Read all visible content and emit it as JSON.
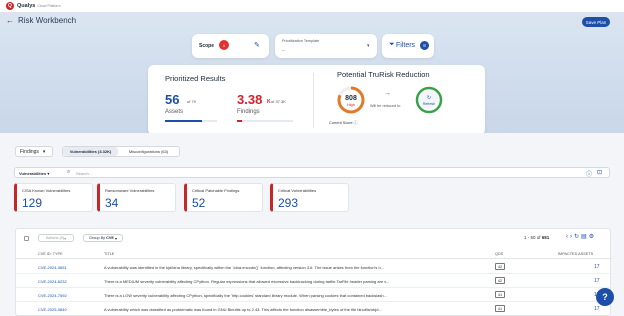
{
  "header": {
    "brand": "Qualys",
    "brand_sub": "Cloud Platform",
    "logo_letter": "Q"
  },
  "page": {
    "back_icon": "back-arrow-icon",
    "title": "Risk Workbench",
    "save_label": "Save Plan"
  },
  "scope": {
    "label": "Scope",
    "badge": "1",
    "edit_icon": "pencil-icon"
  },
  "prioritization": {
    "label": "Prioritization Template",
    "value": "--",
    "caret": "▾"
  },
  "filters": {
    "label": "Filters",
    "count": "8",
    "icon": "funnel-icon"
  },
  "results": {
    "title": "Prioritized Results",
    "assets_value": "56",
    "assets_of": "of 79",
    "assets_label": "Assets",
    "assets_fraction": 0.71,
    "findings_value": "3.38",
    "findings_k": "K",
    "findings_of": "of 37.3K",
    "findings_label": "Findings",
    "findings_fraction": 0.09
  },
  "trurisk": {
    "title": "Potential TruRisk Reduction",
    "current_value": "808",
    "current_level": "High",
    "current_fraction": 0.81,
    "reduced_label": "Will be reduced to",
    "refresh_label": "Refresh",
    "current_score_label": "Current Score",
    "arrow": "→"
  },
  "colors": {
    "accent": "#1d4fa8",
    "critical": "#d2232a",
    "high": "#e07b2a",
    "good": "#3aa14b"
  },
  "toolbar": {
    "findings_label": "Findings",
    "tab_vulnerabilities": "Vulnerabilities (3.32K)",
    "tab_misconfigurations": "Misconfigurations (63)"
  },
  "search": {
    "category": "Vulnerabilities",
    "placeholder": "Search..."
  },
  "stats": [
    {
      "label": "CISA Known Vulnerabilities",
      "value": "129"
    },
    {
      "label": "Ransomware Vulnerabilities",
      "value": "34"
    },
    {
      "label": "Critical Patchable Findings",
      "value": "52"
    },
    {
      "label": "Critical Vulnerabilities",
      "value": "293"
    }
  ],
  "table": {
    "action_label": "Actions (0)",
    "groupby_label": "Group By",
    "groupby_value": "CVE",
    "pagination": "1 - 50 of",
    "total": "681",
    "columns": {
      "cve": "CVE ID: TYPE",
      "title": "TITLE",
      "qds": "QDS",
      "impacted": "IMPACTED ASSETS"
    },
    "rows": [
      {
        "cve": "CVE-2024-3651",
        "title": "A vulnerability was identified in the kjd/idna library, specifically within the `idna.encode()` function, affecting version 3.6. The issue arises from the function's h...",
        "qds": "42",
        "impacted": "17"
      },
      {
        "cve": "CVE-2024-6232",
        "title": "There is a MEDIUM severity vulnerability affecting CPython. Regular expressions that allowed excessive backtracking during tarfile.TarFile header parsing are v...",
        "qds": "42",
        "impacted": "17"
      },
      {
        "cve": "CVE-2024-7592",
        "title": "There is a LOW severity vulnerability affecting CPython, specifically the 'http.cookies' standard library module. When parsing cookies that contained backslash...",
        "qds": "41",
        "impacted": "17"
      },
      {
        "cve": "CVE-2025-0840",
        "title": "A vulnerability which was classified as problematic was found in GNU Binutils up to 2.43. This affects the function disassemble_bytes of the file binutils/objd...",
        "qds": "41",
        "impacted": "17"
      }
    ]
  },
  "help": {
    "label": "?"
  }
}
